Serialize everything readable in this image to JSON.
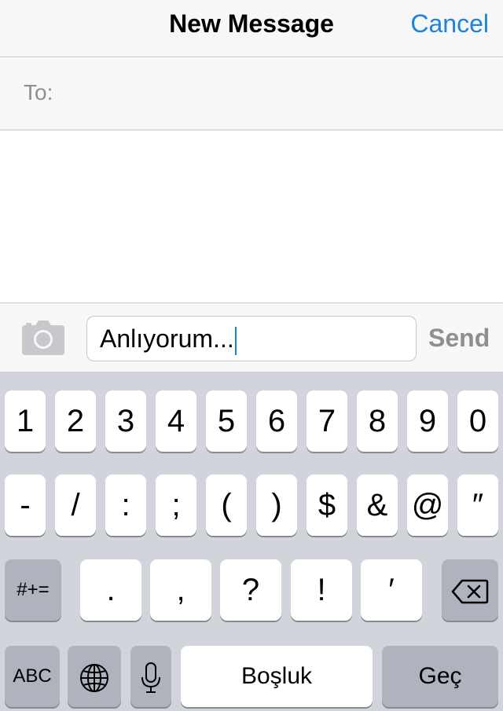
{
  "header": {
    "title": "New Message",
    "cancel_label": "Cancel"
  },
  "recipient": {
    "label": "To:"
  },
  "composer": {
    "camera_icon": "camera-icon",
    "text_value": "Anlıyorum...",
    "send_label": "Send"
  },
  "keyboard": {
    "row1": [
      "1",
      "2",
      "3",
      "4",
      "5",
      "6",
      "7",
      "8",
      "9",
      "0"
    ],
    "row2": [
      "-",
      "/",
      ":",
      ";",
      "(",
      ")",
      "$",
      "&",
      "@",
      "″"
    ],
    "row3": {
      "toggle_label": "#+=",
      "keys": [
        ".",
        ",",
        "?",
        "!",
        "′"
      ],
      "delete_icon": "backspace-icon"
    },
    "row4": {
      "abc_label": "ABC",
      "globe_icon": "globe-icon",
      "mic_icon": "microphone-icon",
      "space_label": "Boşluk",
      "return_label": "Geç"
    }
  },
  "colors": {
    "accent": "#1a82e0",
    "bar_bg": "#f7f7f7",
    "keyboard_bg": "#d1d4db",
    "dark_key": "#aeb3bd",
    "muted_text": "#8e8e93"
  }
}
